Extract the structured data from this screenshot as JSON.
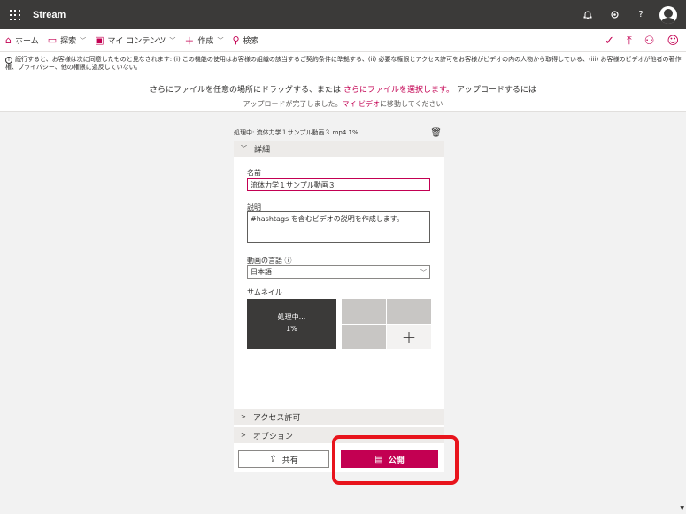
{
  "app": {
    "title": "Stream"
  },
  "top_icons": [
    "bell-icon",
    "gear-icon",
    "help-icon",
    "avatar"
  ],
  "nav": {
    "items": [
      {
        "label": "ホーム",
        "icon": "home-icon",
        "has_chevron": false
      },
      {
        "label": "探索",
        "icon": "explore-icon",
        "has_chevron": true
      },
      {
        "label": "マイ コンテンツ",
        "icon": "content-icon",
        "has_chevron": true
      },
      {
        "label": "作成",
        "icon": "plus-icon",
        "has_chevron": true
      },
      {
        "label": "検索",
        "icon": "search-icon",
        "has_chevron": false
      }
    ],
    "right_icons": [
      "check-icon",
      "upload-icon",
      "person-icon",
      "smiley-icon"
    ]
  },
  "notice": {
    "text": "続行すると、お客様は次に同意したものと見なされます: (i) この機能の使用はお客様の組織の該当するご契約条件に準拠する、(ii) 必要な権限とアクセス許可をお客様がビデオの内の人物から取得している、(iii) お客様のビデオが他者の著作権、プライバシー、他の権限に違反していない。"
  },
  "upload": {
    "prefix": "さらにファイルを任意の場所にドラッグする、または",
    "link": "さらにファイルを選択します。",
    "suffix": "アップロードするには",
    "status_prefix": "アップロードが完了しました。",
    "status_link": "マイ ビデオ",
    "status_suffix": "に移動してください"
  },
  "panel": {
    "file_status": "処理中: 流体力学１サンプル動画３.mp4 1%",
    "details_label": "詳細",
    "name_label": "名前",
    "name_value": "流体力学１サンプル動画３",
    "desc_label": "説明",
    "desc_value": "#hashtags を含むビデオの説明を作成します。",
    "lang_label": "動画の言語 ⓘ",
    "lang_value": "日本語",
    "thumb_label": "サムネイル",
    "thumb_processing": "処理中...",
    "thumb_percent": "1%",
    "access_label": "アクセス許可",
    "options_label": "オプション",
    "share_label": "共有",
    "publish_label": "公開"
  },
  "colors": {
    "accent": "#c30052",
    "topbar": "#3b3a39",
    "highlight": "#e8141c"
  }
}
